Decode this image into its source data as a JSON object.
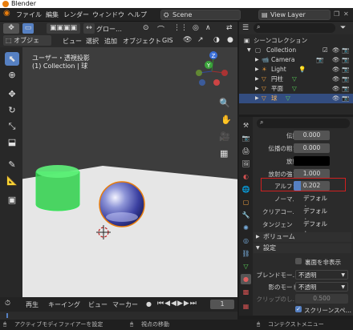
{
  "window_title": "Blender",
  "menu": [
    "ファイル",
    "編集",
    "レンダー",
    "ウィンドウ",
    "ヘルプ"
  ],
  "scene": "Scene",
  "view_layer": "View Layer",
  "viewport_header": {
    "mode": "オブジェク…",
    "items": [
      "ビュー",
      "選択",
      "追加",
      "オブジェクト",
      "GIS"
    ],
    "transform": "グロー…"
  },
  "viewport_overlay": {
    "title": "ユーザー・透視投影",
    "subtitle": "(1) Collection | 球"
  },
  "outliner": {
    "header": "シーンコレクション",
    "items": [
      {
        "label": "Collection"
      },
      {
        "label": "Camera"
      },
      {
        "label": "Light"
      },
      {
        "label": "円柱"
      },
      {
        "label": "平面"
      },
      {
        "label": "球"
      }
    ]
  },
  "properties": {
    "search_placeholder": "",
    "rows": [
      {
        "label": "伝播",
        "value": "0.000"
      },
      {
        "label": "伝播の粗さ",
        "value": "0.000"
      },
      {
        "label": "放射",
        "value": ""
      },
      {
        "label": "放射の強さ",
        "value": "1.000"
      },
      {
        "label": "アルファ",
        "value": "0.202"
      },
      {
        "label": "ノーマル",
        "value": "デフォルト"
      },
      {
        "label": "クリアコー…",
        "value": "デフォルト"
      },
      {
        "label": "タンジェント",
        "value": "デフォルト"
      }
    ],
    "volume_label": "ボリューム",
    "settings_label": "設定",
    "backface_label": "裏面を非表示",
    "blend_mode_label": "ブレンドモー…",
    "blend_mode_value": "不透明",
    "shadow_mode_label": "影のモード",
    "shadow_mode_value": "不透明",
    "clip_label": "クリップのし…",
    "clip_value": "0.500",
    "screenspace_label": "スクリーンスペ…"
  },
  "timeline": {
    "items": [
      "再生",
      "キーイング",
      "ビュー",
      "マーカー"
    ],
    "frame": "1"
  },
  "status_bar": {
    "left": "アクティブモディファイアーを設定",
    "middle": "視点の移動",
    "right": "コンテクストメニュー"
  },
  "colors": {
    "accent": "#5680c2",
    "highlight_box": "#d02020",
    "selected_object": "#e87d0d"
  }
}
